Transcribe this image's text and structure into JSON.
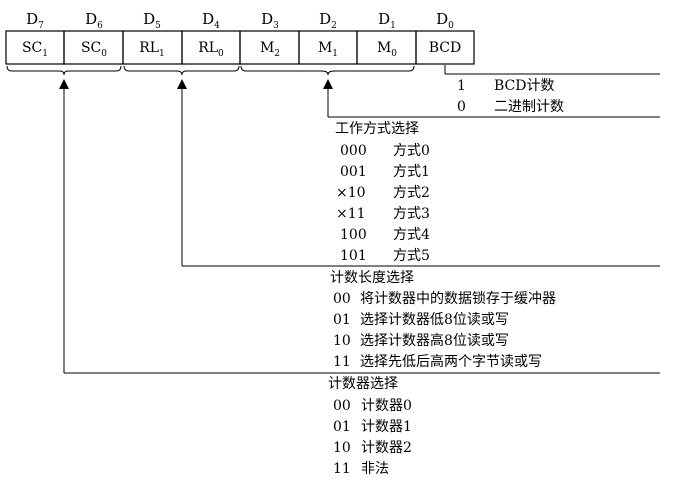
{
  "bits": [
    {
      "base": "D",
      "sub": "7"
    },
    {
      "base": "D",
      "sub": "6"
    },
    {
      "base": "D",
      "sub": "5"
    },
    {
      "base": "D",
      "sub": "4"
    },
    {
      "base": "D",
      "sub": "3"
    },
    {
      "base": "D",
      "sub": "2"
    },
    {
      "base": "D",
      "sub": "1"
    },
    {
      "base": "D",
      "sub": "0"
    }
  ],
  "cells": [
    {
      "base": "SC",
      "sub": "1"
    },
    {
      "base": "SC",
      "sub": "0"
    },
    {
      "base": "RL",
      "sub": "1"
    },
    {
      "base": "RL",
      "sub": "0"
    },
    {
      "base": "M",
      "sub": "2"
    },
    {
      "base": "M",
      "sub": "1"
    },
    {
      "base": "M",
      "sub": "0"
    },
    {
      "base": "BCD",
      "sub": ""
    }
  ],
  "bcd": {
    "options": [
      {
        "code": "1",
        "desc": "BCD计数"
      },
      {
        "code": "0",
        "desc": "二进制计数"
      }
    ]
  },
  "mode": {
    "title": "工作方式选择",
    "options": [
      {
        "code": "000",
        "desc": "方式0"
      },
      {
        "code": "001",
        "desc": "方式1"
      },
      {
        "code": "×10",
        "desc": "方式2"
      },
      {
        "code": "×11",
        "desc": "方式3"
      },
      {
        "code": "100",
        "desc": "方式4"
      },
      {
        "code": "101",
        "desc": "方式5"
      }
    ]
  },
  "rw": {
    "title": "计数长度选择",
    "options": [
      {
        "code": "00",
        "desc": "将计数器中的数据锁存于缓冲器"
      },
      {
        "code": "01",
        "desc": "选择计数器低8位读或写"
      },
      {
        "code": "10",
        "desc": "选择计数器高8位读或写"
      },
      {
        "code": "11",
        "desc": "选择先低后高两个字节读或写"
      }
    ]
  },
  "counter": {
    "title": "计数器选择",
    "options": [
      {
        "code": "00",
        "desc": "计数器0"
      },
      {
        "code": "01",
        "desc": "计数器1"
      },
      {
        "code": "10",
        "desc": "计数器2"
      },
      {
        "code": "11",
        "desc": "非法"
      }
    ]
  }
}
